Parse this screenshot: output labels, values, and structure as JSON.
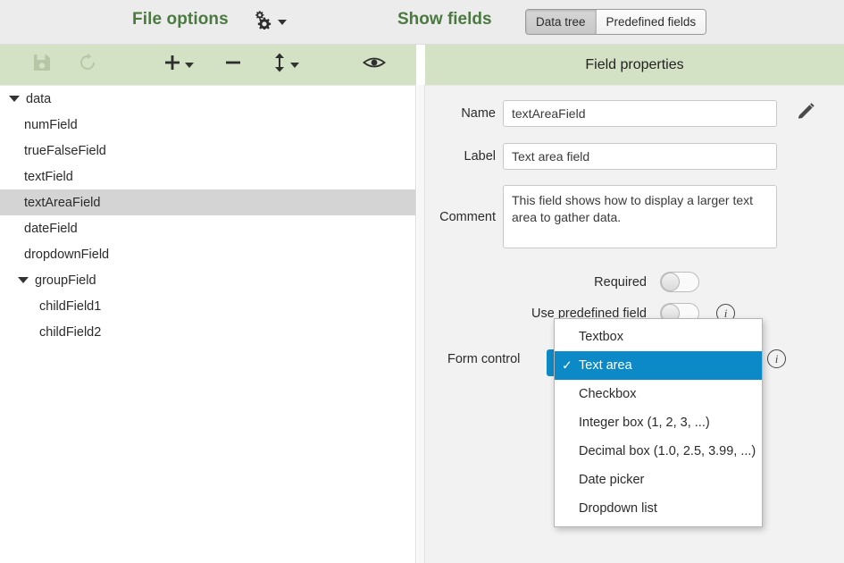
{
  "topbar": {
    "file_options_label": "File options",
    "gears_icon": "gears-icon",
    "gears_caret_icon": "caret-down-icon",
    "show_fields_label": "Show fields",
    "segmented": {
      "options": [
        {
          "label": "Data tree",
          "active": true
        },
        {
          "label": "Predefined fields",
          "active": false
        }
      ]
    }
  },
  "tree_toolbar": {
    "buttons": [
      {
        "name": "save-icon",
        "disabled": true
      },
      {
        "name": "refresh-icon",
        "disabled": true
      },
      {
        "name": "add-icon",
        "disabled": false,
        "caret": true
      },
      {
        "name": "remove-icon",
        "disabled": false,
        "caret": false
      },
      {
        "name": "move-updown-icon",
        "disabled": false,
        "caret": true
      },
      {
        "name": "preview-eye-icon",
        "disabled": false,
        "caret": false
      }
    ]
  },
  "tree": {
    "nodes": [
      {
        "label": "data",
        "depth": 0,
        "expandable": true,
        "expanded": true,
        "selected": false
      },
      {
        "label": "numField",
        "depth": 1,
        "expandable": false,
        "expanded": false,
        "selected": false
      },
      {
        "label": "trueFalseField",
        "depth": 1,
        "expandable": false,
        "expanded": false,
        "selected": false
      },
      {
        "label": "textField",
        "depth": 1,
        "expandable": false,
        "expanded": false,
        "selected": false
      },
      {
        "label": "textAreaField",
        "depth": 1,
        "expandable": false,
        "expanded": false,
        "selected": true
      },
      {
        "label": "dateField",
        "depth": 1,
        "expandable": false,
        "expanded": false,
        "selected": false
      },
      {
        "label": "dropdownField",
        "depth": 1,
        "expandable": false,
        "expanded": false,
        "selected": false
      },
      {
        "label": "groupField",
        "depth": 1,
        "expandable": true,
        "expanded": true,
        "selected": false
      },
      {
        "label": "childField1",
        "depth": 2,
        "expandable": false,
        "expanded": false,
        "selected": false
      },
      {
        "label": "childField2",
        "depth": 2,
        "expandable": false,
        "expanded": false,
        "selected": false
      }
    ]
  },
  "properties": {
    "header_title": "Field properties",
    "name_label": "Name",
    "name_value": "textAreaField",
    "edit_name_icon": "pencil-icon",
    "label_label": "Label",
    "label_value": "Text area field",
    "comment_label": "Comment",
    "comment_value": "This field shows how to display a larger text area to gather data.",
    "required_label": "Required",
    "required_on": false,
    "use_predefined_label": "Use predefined field",
    "use_predefined_on": false,
    "use_predefined_info_icon": "info-icon",
    "form_control_label": "Form control",
    "form_control_value": "Text area",
    "form_control_info_icon": "info-icon"
  },
  "form_control_menu": {
    "items": [
      {
        "label": "Textbox",
        "selected": false
      },
      {
        "label": "Text area",
        "selected": true
      },
      {
        "label": "Checkbox",
        "selected": false
      },
      {
        "label": "Integer box (1, 2, 3, ...)",
        "selected": false
      },
      {
        "label": "Decimal box (1.0, 2.5, 3.99, ...)",
        "selected": false
      },
      {
        "label": "Date picker",
        "selected": false
      },
      {
        "label": "Dropdown list",
        "selected": false
      }
    ],
    "check_glyph": "✓"
  },
  "colors": {
    "brand_green_text": "#4a7a3f",
    "panel_header_green": "#d3e2c4",
    "menu_highlight_blue": "#0c8ac7",
    "tree_selected_gray": "#d4d4d4",
    "topbar_gray": "#ececec",
    "props_bg_gray": "#f2f2f2"
  }
}
